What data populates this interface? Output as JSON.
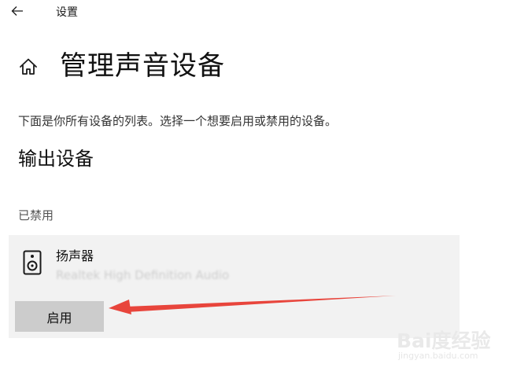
{
  "window": {
    "title": "设置"
  },
  "page": {
    "title": "管理声音设备",
    "description": "下面是你所有设备的列表。选择一个想要启用或禁用的设备。"
  },
  "output_section": {
    "heading": "输出设备",
    "group_label": "已禁用",
    "devices": [
      {
        "name": "扬声器",
        "driver": "Realtek High Definition Audio",
        "button_label": "启用"
      }
    ]
  },
  "watermark": {
    "main": "Bai度经验",
    "sub": "jingyan.baidu.com"
  },
  "colors": {
    "card_background": "#f2f2f2",
    "button_background": "#cccccc",
    "annotation_arrow": "#e8453c"
  },
  "icons": {
    "back": "back-arrow-icon",
    "home": "home-icon",
    "device": "speaker-icon"
  }
}
